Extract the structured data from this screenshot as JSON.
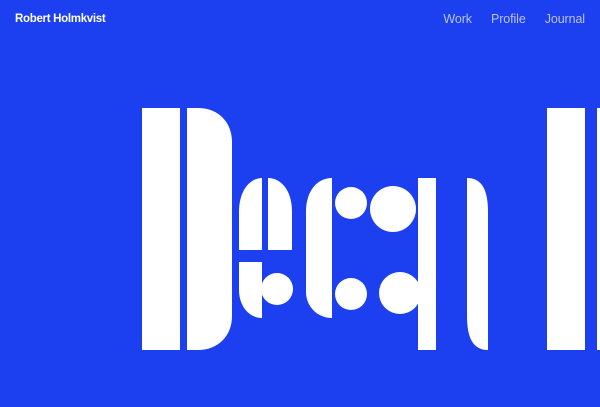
{
  "header": {
    "brand": "Robert Holmkvist",
    "nav": [
      {
        "label": "Work"
      },
      {
        "label": "Profile"
      },
      {
        "label": "Journal"
      }
    ]
  },
  "hero": {
    "word": "Decad",
    "color": "#ffffff"
  },
  "colors": {
    "background": "#1c3ff0",
    "brand_text": "#ffffff",
    "nav_text": "#b9c3f7"
  }
}
